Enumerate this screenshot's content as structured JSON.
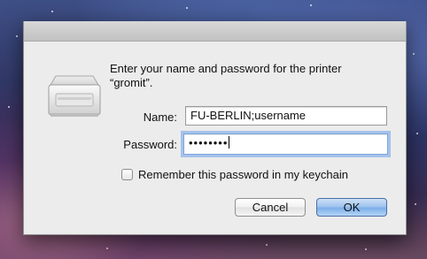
{
  "dialog": {
    "message_line1": "Enter your name and password for the printer",
    "message_line2": "“gromit”.",
    "name_label": "Name:",
    "name_value": "FU-BERLIN;username",
    "password_label": "Password:",
    "password_masked": "••••••••",
    "remember_label": "Remember this password in my keychain",
    "remember_checked": false,
    "cancel_label": "Cancel",
    "ok_label": "OK"
  },
  "icons": {
    "printer": "printer-icon"
  }
}
